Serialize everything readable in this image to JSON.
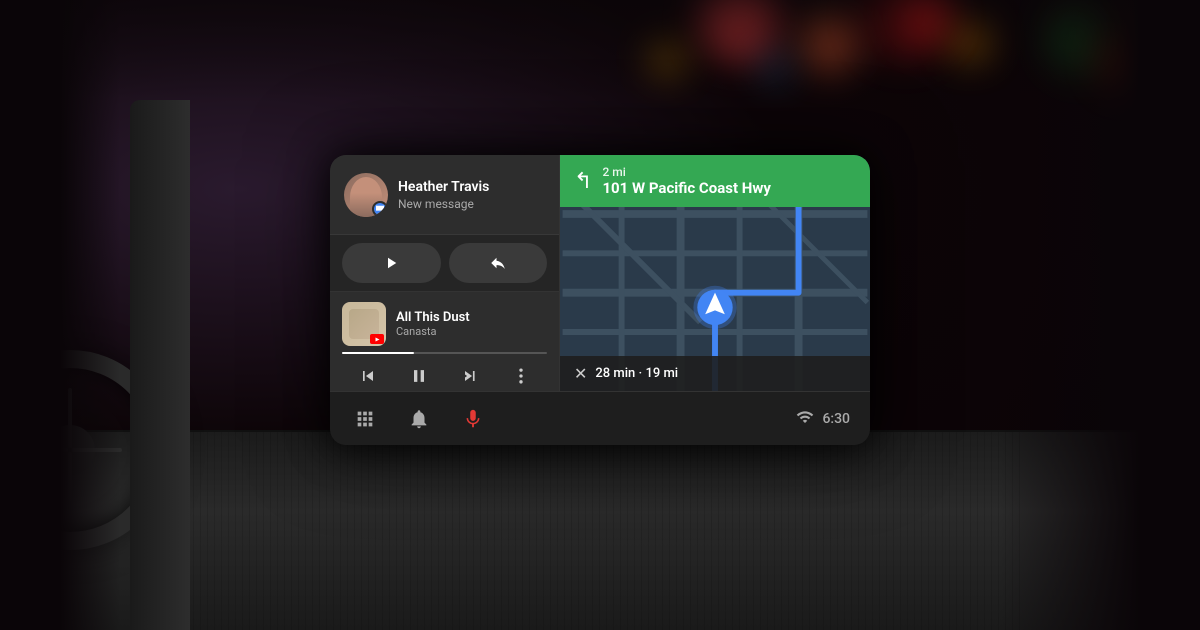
{
  "screen": {
    "message": {
      "sender_name": "Heather Travis",
      "message_type": "New message",
      "avatar_alt": "Heather Travis avatar"
    },
    "reply_buttons": {
      "play_label": "▶",
      "reply_label": "↩"
    },
    "music": {
      "song_title": "All This Dust",
      "artist": "Canasta",
      "progress_percent": 35
    },
    "navigation": {
      "turn_distance": "2 mi",
      "street_name": "101 W Pacific Coast Hwy",
      "eta_minutes": "28 min",
      "eta_miles": "19 mi",
      "turn_direction": "↰"
    },
    "bottom_nav": {
      "apps_label": "Apps",
      "notifications_label": "Notifications",
      "mic_label": "Microphone"
    },
    "status": {
      "time": "6:30",
      "signal": "▐▐"
    }
  },
  "colors": {
    "green_nav": "#34A853",
    "blue_accent": "#4285F4",
    "dark_bg": "#1e1e1e",
    "card_bg": "#2d2d2d",
    "red_youtube": "#FF0000",
    "mic_red": "#E53935"
  }
}
